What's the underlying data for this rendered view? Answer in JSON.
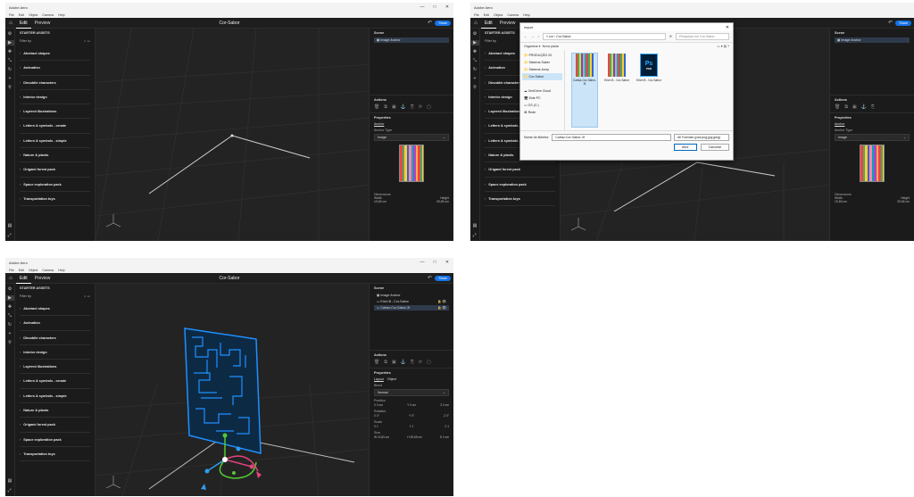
{
  "app": {
    "title": "Adobe Aero",
    "menu": [
      "File",
      "Edit",
      "Object",
      "Camera",
      "Help"
    ],
    "home_icon": "home-icon",
    "tabs": [
      "Edit",
      "Preview"
    ],
    "doc_title": "Cor-Sabor",
    "share": "Share",
    "window_controls": [
      "—",
      "□",
      "✕"
    ]
  },
  "assets": {
    "header": "STARTER ASSETS",
    "filter": "Filter by",
    "items": [
      "Abstract shapes",
      "Animation",
      "Dinoddle characters",
      "Interior design",
      "Layered illustrations",
      "Letters & symbols - ornate",
      "Letters & symbols - simple",
      "Nature & plants",
      "Origami forest pack",
      "Space exploration pack",
      "Transportation toys"
    ]
  },
  "panel1": {
    "scene_title": "Scene",
    "scene_items": [
      "Image Anchor"
    ],
    "actions_title": "Actions",
    "properties_title": "Properties",
    "anchor_label": "Anchor",
    "anchor_type_label": "Anchor Type",
    "anchor_type_value": "Image",
    "dimensions_label": "Dimensions",
    "width_label": "Width",
    "height_label": "Height",
    "width_value": "19,83 cm",
    "height_value": "39,65 cm"
  },
  "dialog": {
    "title": "Import",
    "path": "« cor › Cor-Sabor",
    "search": "Pesquisar em Cor-Sabor",
    "organize": "Organizar ▾",
    "new_folder": "Nova pasta",
    "nav": [
      "PRODUÇÃO 20",
      "Sistema Saber",
      "Sistema Jump",
      "Cor-Sabor",
      "OneDrive Cloud",
      "Este PC",
      "OS (C:)",
      "Rede"
    ],
    "files": [
      "Cartaz-Cor-Sabor-3f",
      "Erich B - Cor-Sabor",
      "Erich B - Cor-Sabor"
    ],
    "psd_label": "Ps",
    "psd_ext": "PSD",
    "filename_label": "Nome do ficheiro:",
    "filename_value": "Cartaz-Cor-Sabor-3f",
    "filetype": "All Formats (psd;png;jpg;jpeg)",
    "open": "Abrir",
    "cancel": "Cancelar"
  },
  "panel3": {
    "scene_title": "Scene",
    "scene_items": [
      "Image Anchor",
      "Erich B - Cor-Sabor",
      "Cartaz-Cor-Sabor-3f"
    ],
    "actions_title": "Actions",
    "properties_title": "Properties",
    "layout_tab": "Layout",
    "object_tab": "Object",
    "blend_label": "Blend",
    "blend_value": "Normal",
    "position_label": "Position",
    "pos": [
      "X  0 cm",
      "Y  0 cm",
      "Z  0 cm"
    ],
    "rotation_label": "Rotation",
    "rot": [
      "X  0°",
      "Y  0°",
      "Z  0°"
    ],
    "scale_label": "Scale",
    "scale": [
      "X  1",
      "Y  1",
      "Z  1"
    ],
    "size_label": "Size",
    "size": [
      "W  19,83 cm",
      "H  39,65 cm",
      "D  0 cm"
    ]
  },
  "colors": {
    "accent": "#1473e6",
    "grid": "#3a3a3a",
    "gizmo_red": "#e0457b",
    "gizmo_green": "#53c932",
    "gizmo_blue": "#2d9cf0",
    "object_blue": "#1e90ff"
  }
}
